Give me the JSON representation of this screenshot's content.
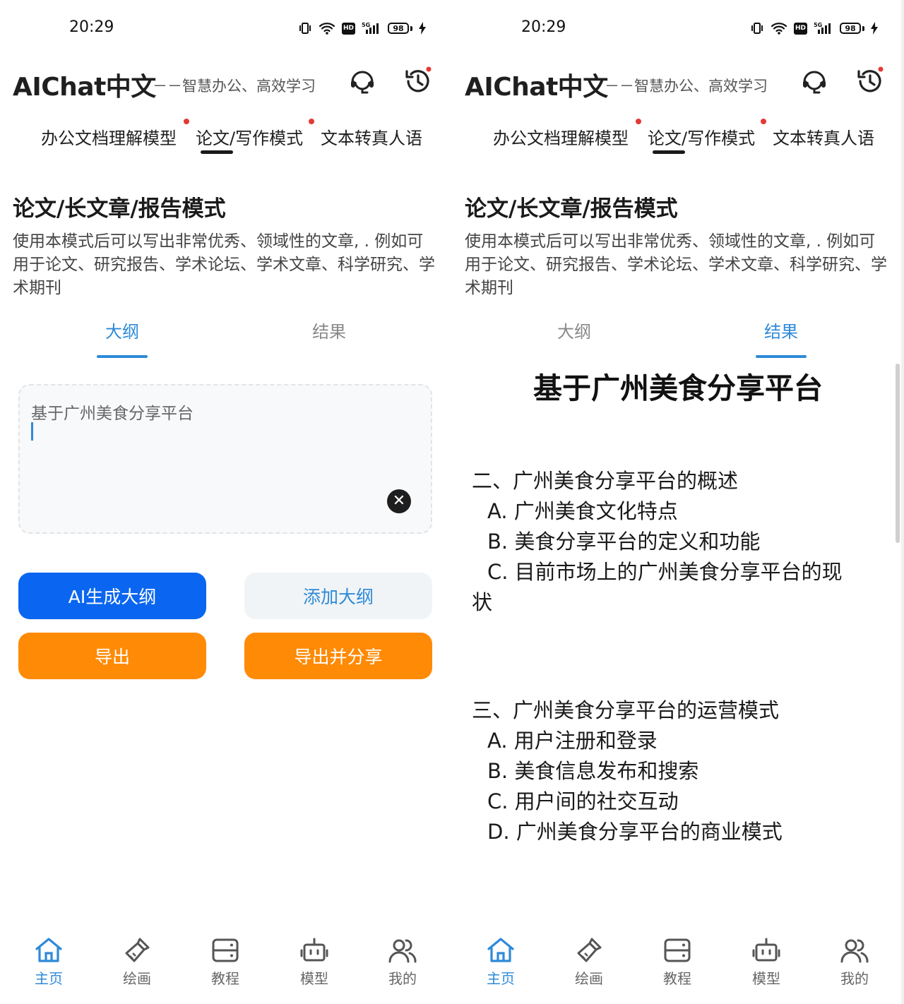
{
  "status_bar": {
    "time": "20:29",
    "battery": "98"
  },
  "header": {
    "title": "AIChat中文",
    "subtitle": "－－智慧办公、高效学习"
  },
  "mode_tabs": [
    {
      "label": "办公文档理解模型",
      "badge": true
    },
    {
      "label": "论文/写作模式",
      "badge": true,
      "active": true
    },
    {
      "label": "文本转真人语",
      "badge": false
    }
  ],
  "section": {
    "title": "论文/长文章/报告模式",
    "description": "使用本模式后可以写出非常优秀、领域性的文章, . 例如可用于论文、研究报告、学术论坛、学术文章、科学研究、学术期刊"
  },
  "sub_tabs": [
    "大纲",
    "结果"
  ],
  "left_screen": {
    "active_sub_tab": "大纲",
    "outline_input_value": "基于广州美食分享平台",
    "buttons": {
      "ai_generate": "AI生成大纲",
      "add_outline": "添加大纲",
      "export": "导出",
      "export_share": "导出并分享"
    }
  },
  "right_screen": {
    "active_sub_tab": "结果",
    "result": {
      "title": "基于广州美食分享平台",
      "sections": [
        {
          "heading": "二、广州美食分享平台的概述",
          "items": [
            "A. 广州美食文化特点",
            "B. 美食分享平台的定义和功能",
            "C. 目前市场上的广州美食分享平台的现",
            "状"
          ]
        },
        {
          "heading": "三、广州美食分享平台的运营模式",
          "items": [
            "A. 用户注册和登录",
            "B. 美食信息发布和搜索",
            "C. 用户间的社交互动",
            "D. 广州美食分享平台的商业模式"
          ]
        }
      ]
    }
  },
  "bottom_nav": [
    {
      "label": "主页",
      "icon": "home-icon",
      "active": true
    },
    {
      "label": "绘画",
      "icon": "paintbrush-icon",
      "active": false
    },
    {
      "label": "教程",
      "icon": "server-icon",
      "active": false
    },
    {
      "label": "模型",
      "icon": "robot-icon",
      "active": false
    },
    {
      "label": "我的",
      "icon": "users-icon",
      "active": false
    }
  ],
  "colors": {
    "accent_blue": "#2e8ad8",
    "primary_button": "#0a66f0",
    "orange_button": "#ff8a05",
    "badge_red": "#e53935"
  }
}
